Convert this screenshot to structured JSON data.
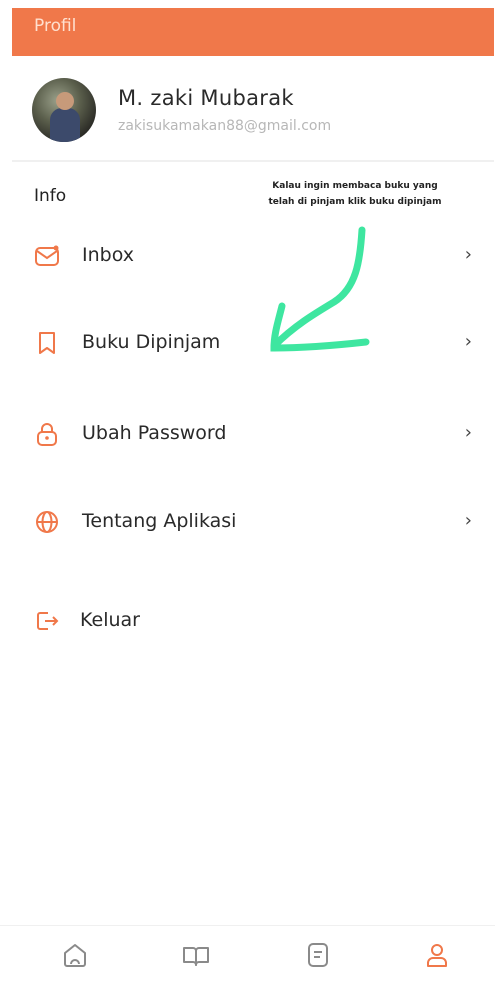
{
  "header": {
    "title": "Profil"
  },
  "profile": {
    "name": "M. zaki Mubarak",
    "email": "zakisukamakan88@gmail.com"
  },
  "section": {
    "title": "Info"
  },
  "annotation": {
    "line1": "Kalau ingin membaca buku yang",
    "line2": "telah di pinjam klik buku dipinjam"
  },
  "menu": {
    "items": [
      {
        "label": "Inbox",
        "icon": "mail-icon",
        "chevron": "›"
      },
      {
        "label": "Buku Dipinjam",
        "icon": "bookmark-icon",
        "chevron": "›"
      },
      {
        "label": "Ubah Password",
        "icon": "lock-icon",
        "chevron": "›"
      },
      {
        "label": "Tentang Aplikasi",
        "icon": "globe-icon",
        "chevron": "›"
      },
      {
        "label": "Keluar",
        "icon": "logout-icon"
      }
    ]
  },
  "bottom_nav": [
    "home-icon",
    "book-open-icon",
    "document-icon",
    "user-icon"
  ],
  "colors": {
    "accent": "#f0784a",
    "annotation_arrow": "#3ee6a0"
  }
}
